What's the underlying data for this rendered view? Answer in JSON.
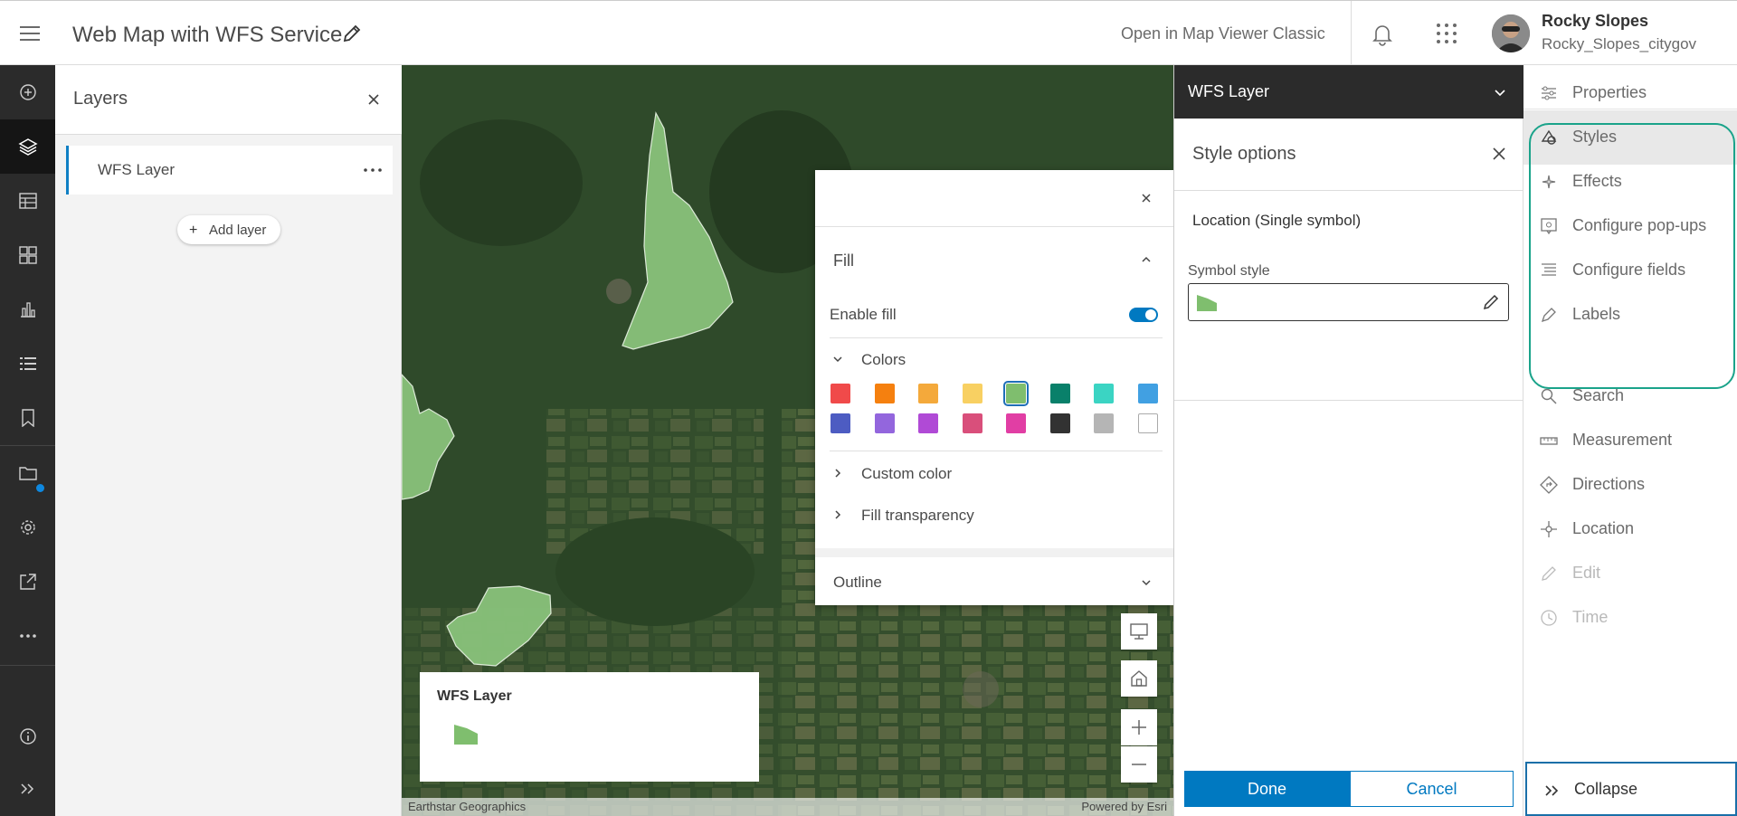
{
  "header": {
    "title": "Web Map with WFS Service",
    "open_classic": "Open in Map Viewer Classic",
    "user_name": "Rocky Slopes",
    "user_login": "Rocky_Slopes_citygov"
  },
  "left_rail": {
    "icons": [
      "add-icon",
      "layers-icon",
      "table-icon",
      "basemap-icon",
      "charts-icon",
      "legend-icon",
      "bookmark-icon",
      "folder-icon",
      "settings-icon",
      "share-icon",
      "more-icon",
      "info-icon",
      "expand-icon"
    ],
    "active": "layers-icon"
  },
  "layers_panel": {
    "title": "Layers",
    "layer_name": "WFS Layer",
    "add_layer": "Add layer"
  },
  "fill_popup": {
    "fill_label": "Fill",
    "enable_fill_label": "Enable fill",
    "enable_fill": true,
    "colors_label": "Colors",
    "swatches": [
      "#f04a4a",
      "#f5800f",
      "#f4a93b",
      "#f8d062",
      "#7fbe6e",
      "#09806a",
      "#3bd4c3",
      "#41a0e2",
      "#4d5cc2",
      "#9366dd",
      "#b04ad6",
      "#d94f7b",
      "#e13ea4",
      "#323232",
      "#b5b5b5",
      "#ffffff"
    ],
    "selected_swatch": 4,
    "custom_color_label": "Custom color",
    "fill_transparency_label": "Fill transparency",
    "outline_label": "Outline"
  },
  "legend": {
    "title": "WFS Layer",
    "symbol_color": "#7fbe6e"
  },
  "attribution": {
    "left": "Earthstar Geographics",
    "right": "Powered by Esri"
  },
  "style_panel": {
    "layer_header": "WFS Layer",
    "title": "Style options",
    "location_label": "Location (Single symbol)",
    "symbol_style_label": "Symbol style",
    "done_label": "Done",
    "cancel_label": "Cancel"
  },
  "tools": {
    "items": [
      {
        "label": "Properties",
        "icon": "sliders-icon",
        "state": "normal"
      },
      {
        "label": "Styles",
        "icon": "styles-icon",
        "state": "active"
      },
      {
        "label": "Effects",
        "icon": "sparkle-icon",
        "state": "normal"
      },
      {
        "label": "Configure pop-ups",
        "icon": "popup-icon",
        "state": "normal"
      },
      {
        "label": "Configure fields",
        "icon": "fields-icon",
        "state": "normal"
      },
      {
        "label": "Labels",
        "icon": "label-icon",
        "state": "normal"
      },
      {
        "label": "Search",
        "icon": "search-icon",
        "state": "normal"
      },
      {
        "label": "Measurement",
        "icon": "ruler-icon",
        "state": "normal"
      },
      {
        "label": "Directions",
        "icon": "directions-icon",
        "state": "normal"
      },
      {
        "label": "Location",
        "icon": "crosshair-icon",
        "state": "normal"
      },
      {
        "label": "Edit",
        "icon": "edit-icon",
        "state": "disabled"
      },
      {
        "label": "Time",
        "icon": "clock-icon",
        "state": "disabled"
      }
    ],
    "collapse_label": "Collapse"
  },
  "colors": {
    "accent": "#0079c1",
    "highlight": "#1aa38a",
    "rail": "#2b2b2b"
  }
}
